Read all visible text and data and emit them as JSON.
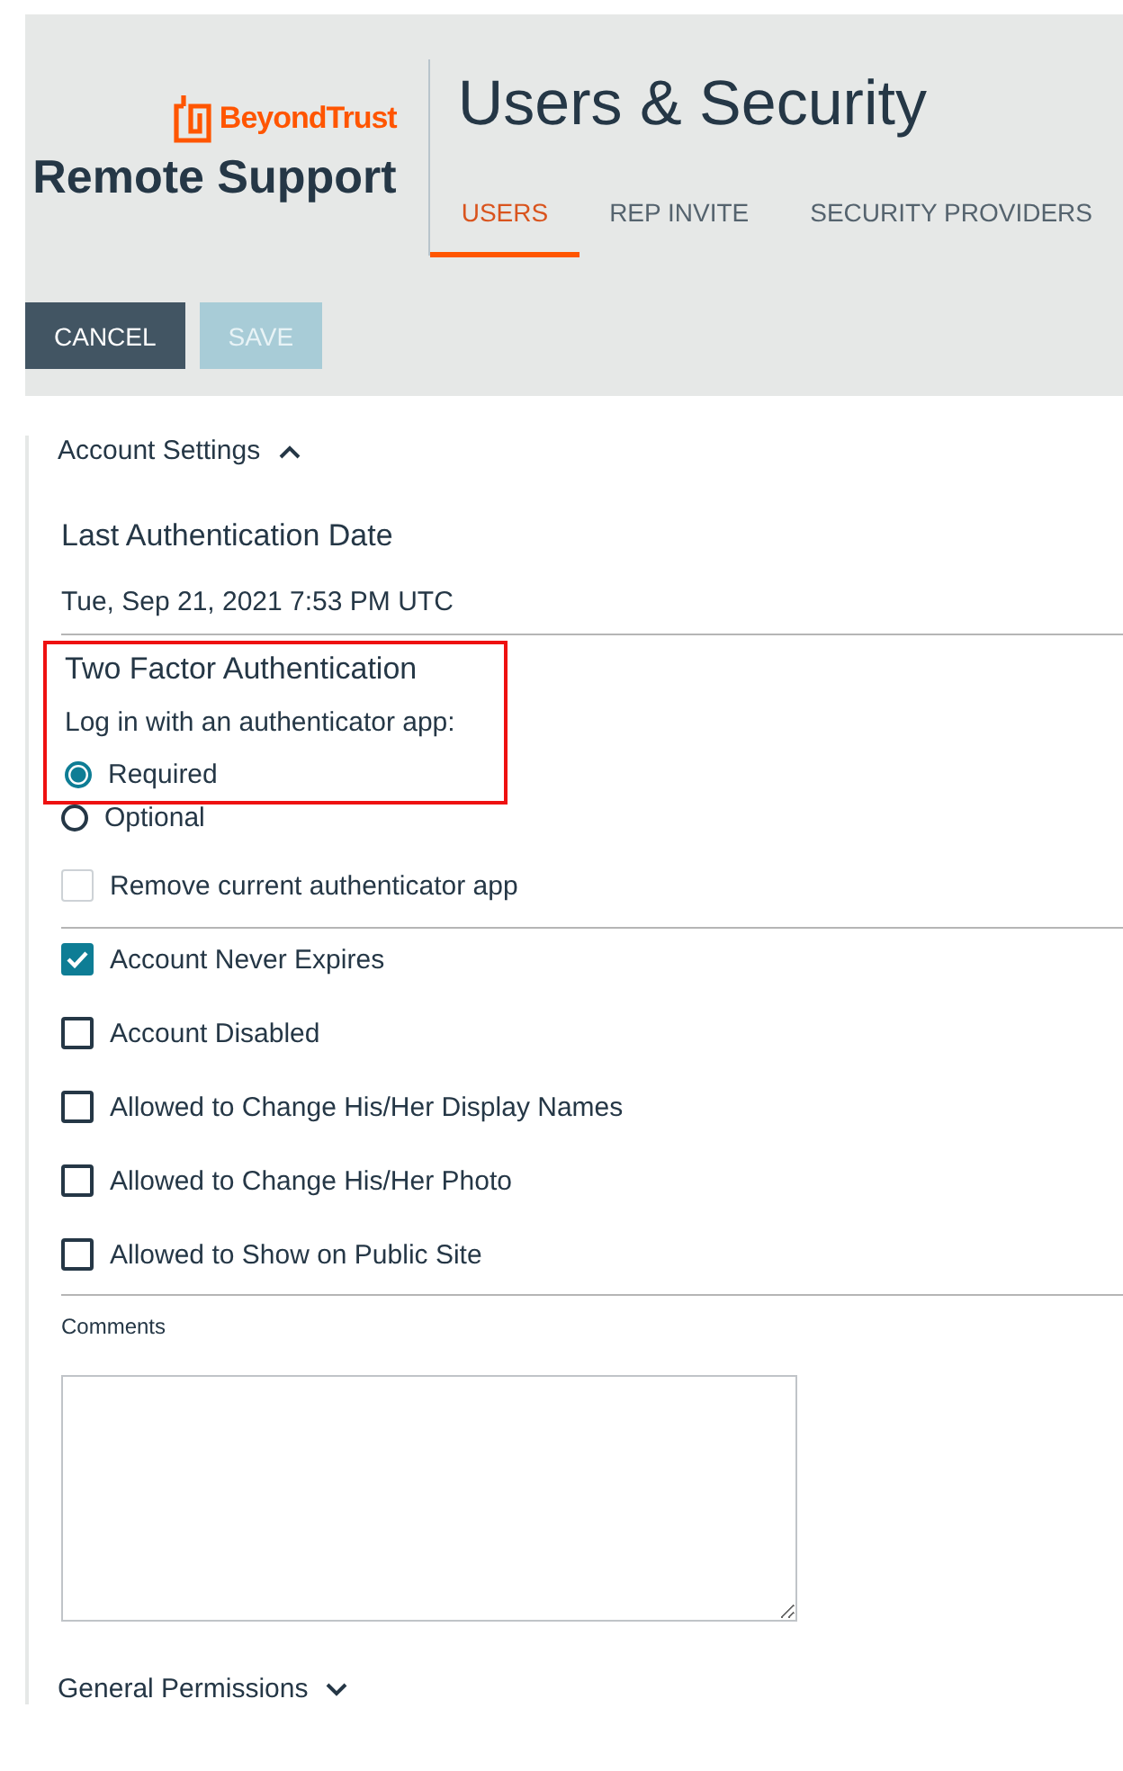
{
  "brand": {
    "company": "BeyondTrust",
    "product": "Remote Support"
  },
  "page_title": "Users & Security",
  "tabs": [
    {
      "label": "USERS",
      "selected": true
    },
    {
      "label": "REP INVITE",
      "selected": false
    },
    {
      "label": "SECURITY PROVIDERS",
      "selected": false
    }
  ],
  "buttons": [
    {
      "label": "CANCEL",
      "disabled": false
    },
    {
      "label": "SAVE",
      "disabled": true
    }
  ],
  "account_settings": {
    "title": "Account Settings",
    "expanded": true,
    "last_auth": {
      "label": "Last Authentication Date",
      "value": "Tue, Sep 21, 2021 7:53 PM UTC"
    },
    "two_factor": {
      "title": "Two Factor Authentication",
      "prompt": "Log in with an authenticator app:",
      "highlighted": true,
      "options": [
        {
          "label": "Required",
          "selected": true
        },
        {
          "label": "Optional",
          "selected": false
        }
      ],
      "remove_app": {
        "label": "Remove current authenticator app",
        "checked": false,
        "disabled": true
      }
    },
    "checkboxes": [
      {
        "label": "Account Never Expires",
        "checked": true
      },
      {
        "label": "Account Disabled",
        "checked": false
      },
      {
        "label": "Allowed to Change His/Her Display Names",
        "checked": false
      },
      {
        "label": "Allowed to Change His/Her Photo",
        "checked": false
      },
      {
        "label": "Allowed to Show on Public Site",
        "checked": false
      }
    ],
    "comments": {
      "label": "Comments"
    }
  },
  "general_permissions": {
    "title": "General Permissions",
    "expanded": false
  }
}
